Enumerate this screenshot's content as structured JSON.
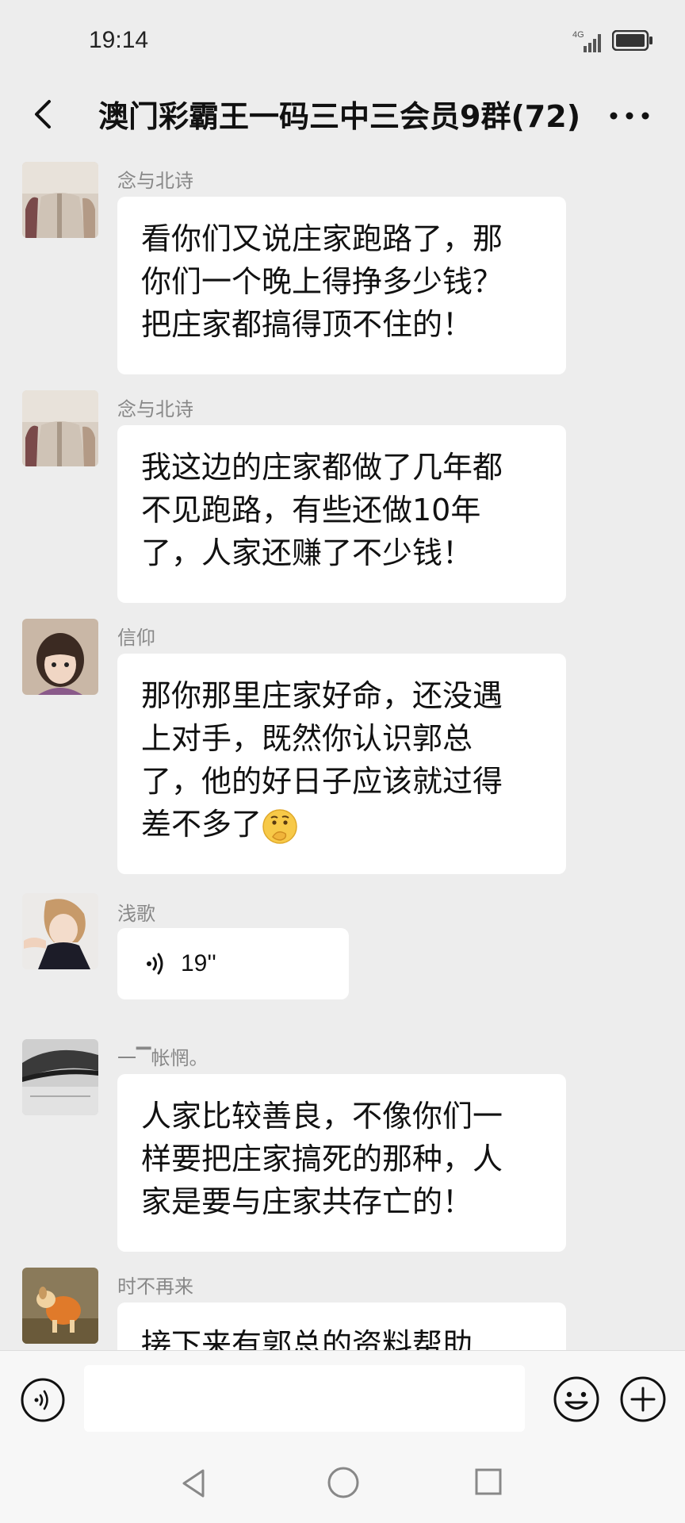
{
  "status_bar": {
    "time": "19:14",
    "network": "4G"
  },
  "header": {
    "title": "澳门彩霸王一码三中三会员9群(72)",
    "back_icon": "chevron-left-icon",
    "more_icon": "more-dots-icon"
  },
  "messages": [
    {
      "sender": "念与北诗",
      "lines": [
        "看你们又说庄家跑路了，那",
        "你们一个晚上得挣多少钱？",
        "把庄家都搞得顶不住的！"
      ]
    },
    {
      "sender": "念与北诗",
      "lines": [
        "我这边的庄家都做了几年都",
        "不见跑路，有些还做10年",
        "了，人家还赚了不少钱！"
      ]
    },
    {
      "sender": "信仰",
      "lines": [
        "那你那里庄家好命，还没遇",
        "上对手，既然你认识郭总",
        "了，他的好日子应该就过得",
        "差不多了"
      ]
    },
    {
      "sender": "浅歌",
      "voice_duration": "19''"
    },
    {
      "sender": "一▔帐惘。",
      "lines": [
        "人家比较善良，不像你们一",
        "样要把庄家搞死的那种，人",
        "家是要与庄家共存亡的！"
      ]
    },
    {
      "sender": "时不再来",
      "lines": [
        "接下来有郭总的资料帮助"
      ]
    }
  ],
  "input_bar": {
    "placeholder": "",
    "value": ""
  },
  "colors": {
    "background": "#ededed",
    "bubble": "#ffffff",
    "sender": "#888888"
  }
}
